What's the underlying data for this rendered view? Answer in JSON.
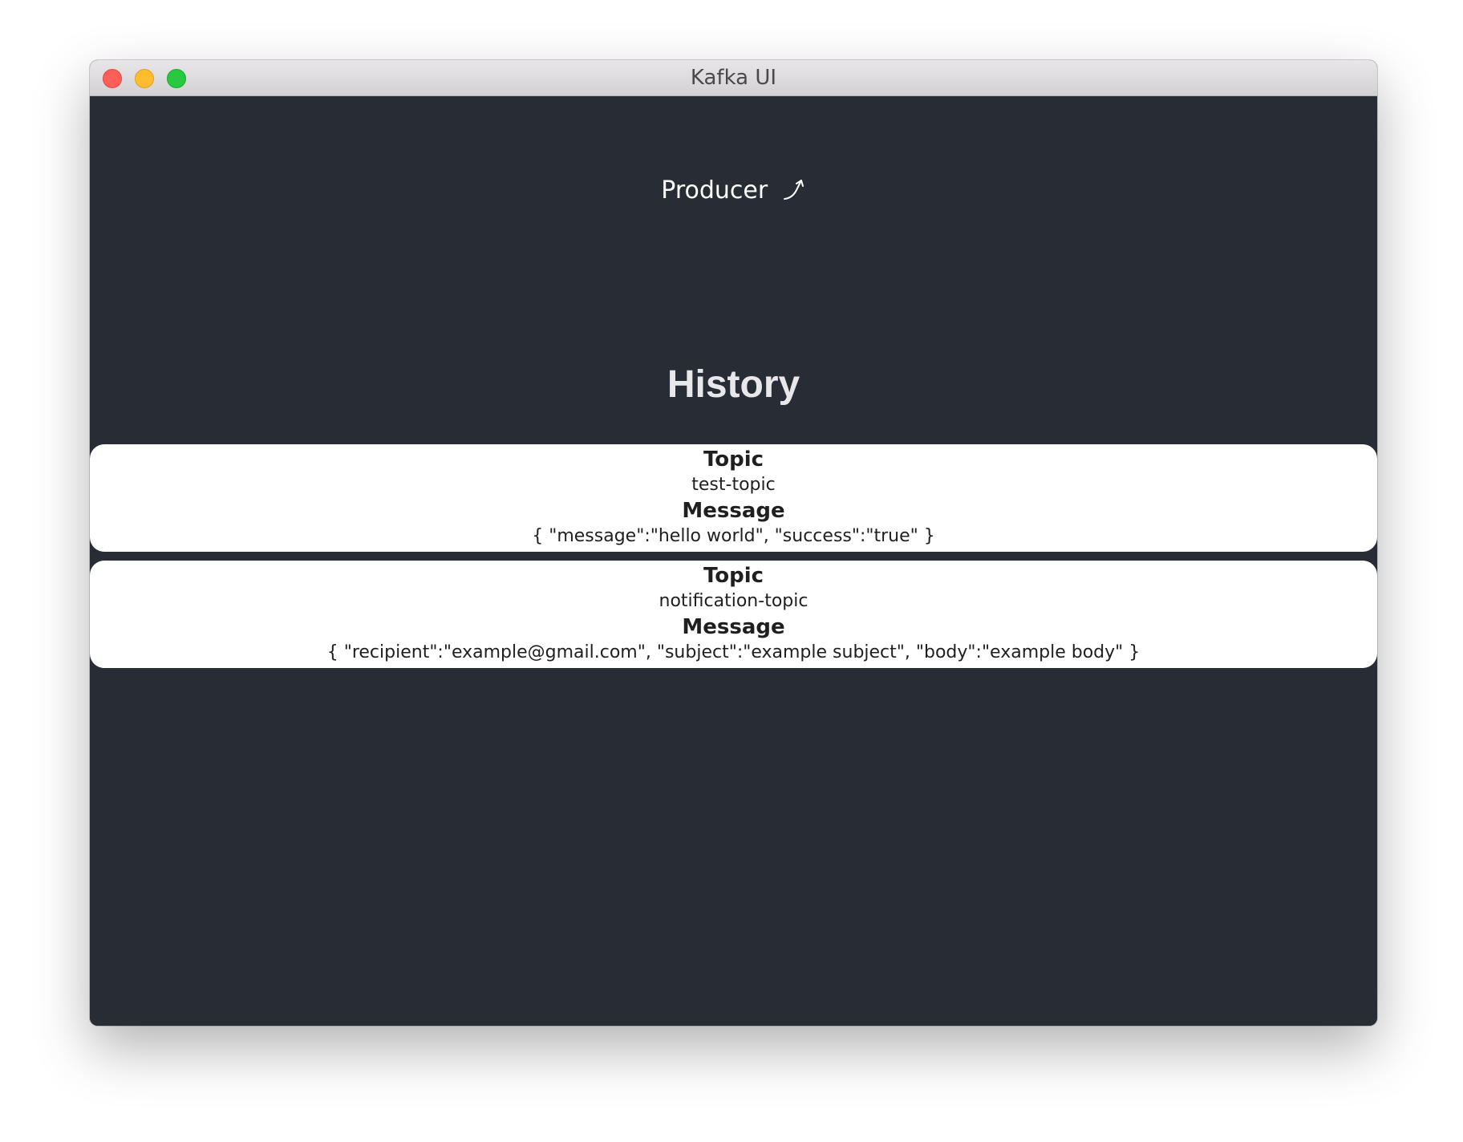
{
  "window": {
    "title": "Kafka UI"
  },
  "nav": {
    "producer_label": "Producer",
    "producer_icon": "arrow-up-right-curved-icon"
  },
  "history": {
    "heading": "History",
    "items": [
      {
        "topic_label": "Topic",
        "topic": "test-topic",
        "message_label": "Message",
        "message": "{ \"message\":\"hello world\", \"success\":\"true\" }"
      },
      {
        "topic_label": "Topic",
        "topic": "notification-topic",
        "message_label": "Message",
        "message": "{ \"recipient\":\"example@gmail.com\", \"subject\":\"example subject\", \"body\":\"example body\" }"
      }
    ]
  },
  "colors": {
    "background": "#282c35",
    "card": "#ffffff",
    "heading_text": "#e8e8ea"
  }
}
